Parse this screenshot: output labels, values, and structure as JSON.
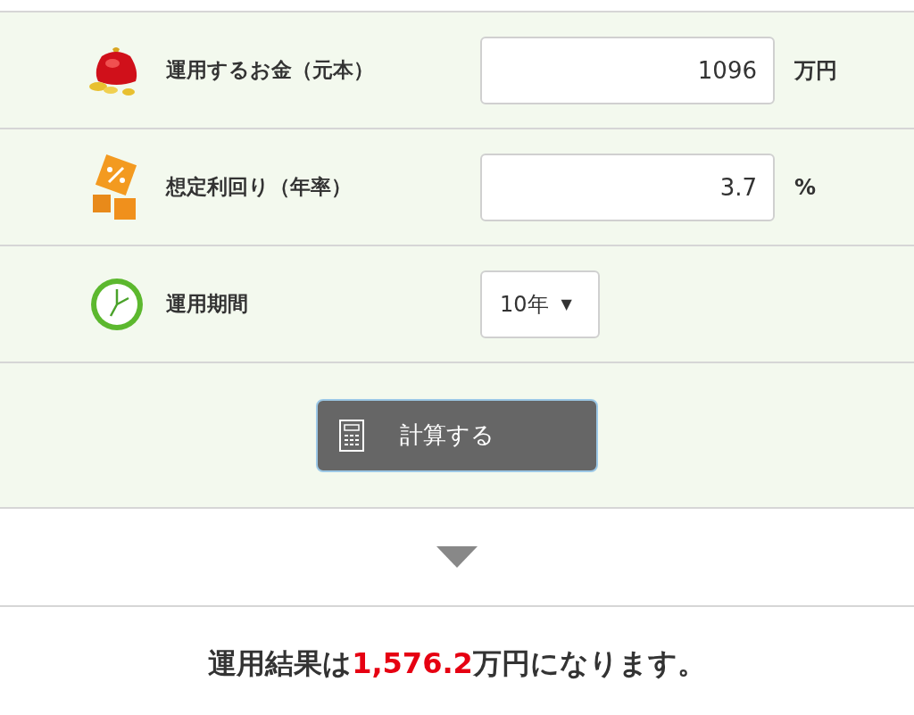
{
  "form_rows": [
    {
      "kind": "input",
      "label": "運用するお金（元本）",
      "value": "1096",
      "unit": "万円"
    },
    {
      "kind": "input",
      "label": "想定利回り（年率）",
      "value": "3.7",
      "unit": "%"
    },
    {
      "kind": "select",
      "label": "運用期間",
      "value": "10年",
      "caret": "▼"
    }
  ],
  "calculate_button": {
    "label": "計算する"
  },
  "result": {
    "prefix": "運用結果は",
    "amount": "1,576.2",
    "suffix": "万円になります。"
  }
}
